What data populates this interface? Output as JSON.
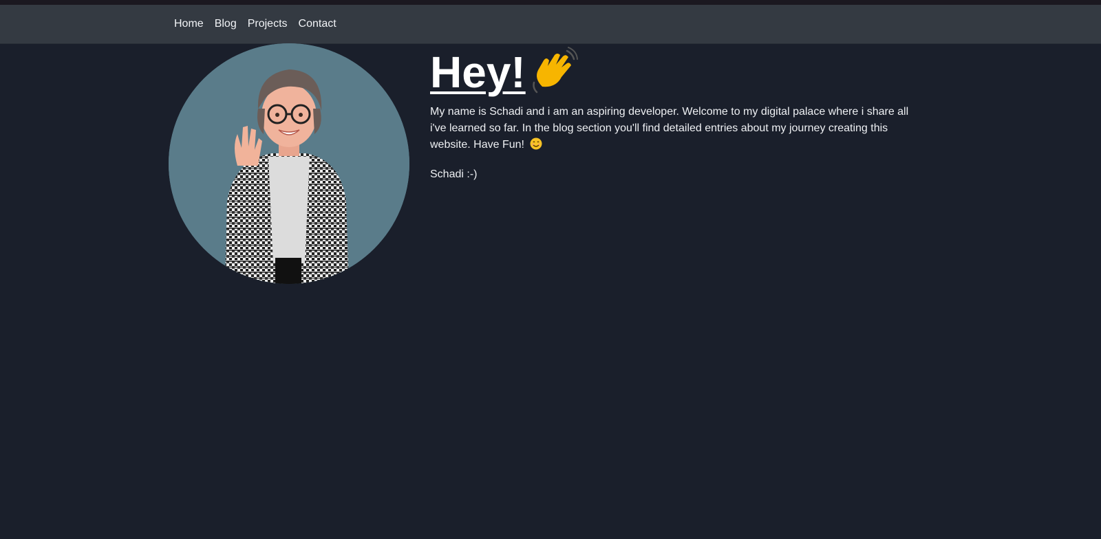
{
  "nav": {
    "items": [
      {
        "label": "Home"
      },
      {
        "label": "Blog"
      },
      {
        "label": "Projects"
      },
      {
        "label": "Contact"
      }
    ]
  },
  "hero": {
    "title": "Hey!",
    "title_icon": "waving-hand-icon",
    "intro": "My name is Schadi and i am an aspiring developer. Welcome to my digital palace where i share all i've learned so far. In the blog section you'll find detailed entries about my journey creating this website. Have Fun!",
    "intro_icon": "smiling-face-icon",
    "signoff": "Schadi :-)",
    "avatar_icon": "avatar-portrait"
  },
  "colors": {
    "background": "#1a1f2b",
    "navbar": "#343a42",
    "avatar_bg": "#5a7c8a",
    "text": "#f2f4f7"
  }
}
